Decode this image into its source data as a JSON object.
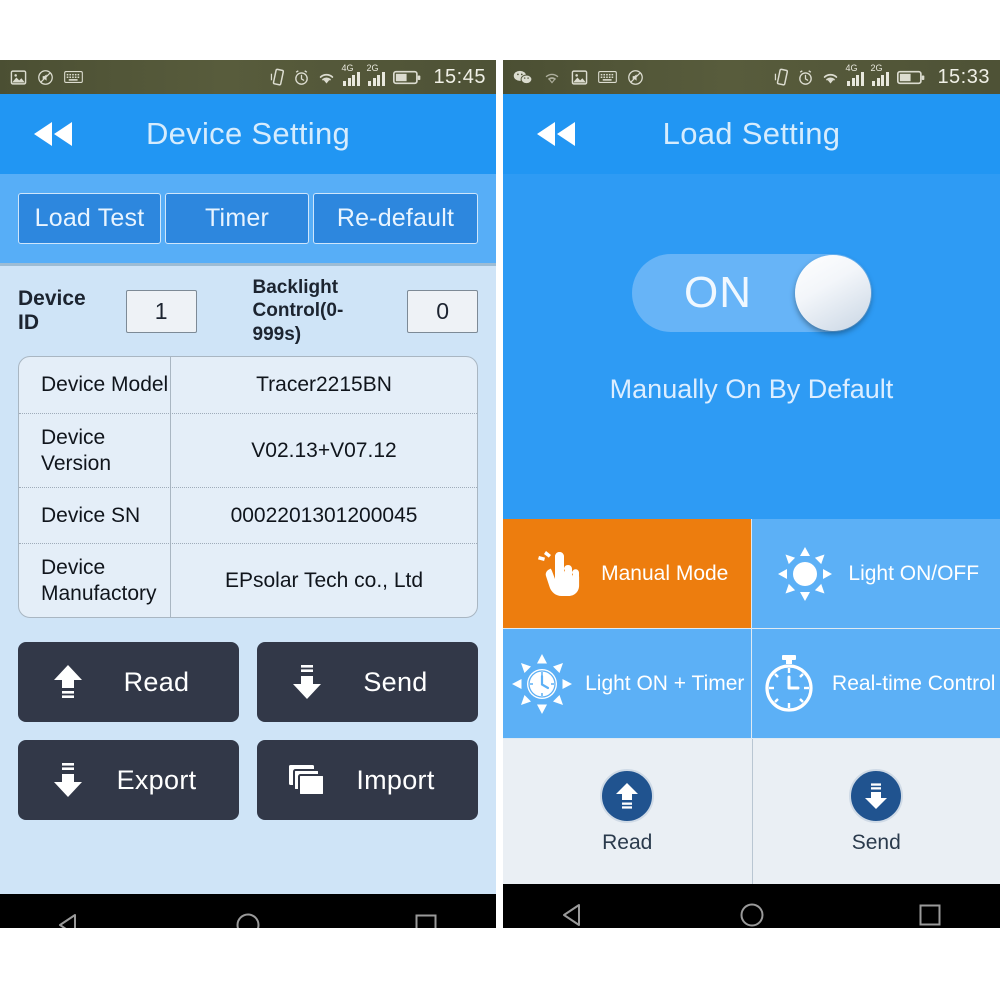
{
  "left": {
    "statusbar": {
      "time": "15:45",
      "left_icons": [
        "image-icon",
        "no-sound-icon",
        "keyboard-icon"
      ],
      "right_icons": [
        "vibrate-icon",
        "alarm-icon",
        "wifi-icon",
        "signal-4g-icon",
        "signal-2g-icon",
        "battery-icon"
      ],
      "net_4g_label": "4G",
      "net_2g_label": "2G"
    },
    "appbar": {
      "title": "Device Setting",
      "back_label": "back"
    },
    "tabs": [
      {
        "label": "Load Test",
        "name": "tab-load-test"
      },
      {
        "label": "Timer",
        "name": "tab-timer"
      },
      {
        "label": "Re-default",
        "name": "tab-re-default"
      }
    ],
    "fields": {
      "device_id_label": "Device ID",
      "device_id_value": "1",
      "backlight_label": "Backlight\nControl(0-999s)",
      "backlight_label_line1": "Backlight",
      "backlight_label_line2": "Control(0-999s)",
      "backlight_value": "0"
    },
    "table": [
      {
        "key": "Device Model",
        "value": "Tracer2215BN"
      },
      {
        "key": "Device Version",
        "value": "V02.13+V07.12"
      },
      {
        "key": "Device SN",
        "value": "0002201301200045"
      },
      {
        "key": "Device Manufactory",
        "value": "EPsolar Tech co., Ltd"
      }
    ],
    "buttons": [
      {
        "label": "Read",
        "icon": "arrow-up-icon"
      },
      {
        "label": "Send",
        "icon": "arrow-down-icon"
      },
      {
        "label": "Export",
        "icon": "arrow-down-icon"
      },
      {
        "label": "Import",
        "icon": "copy-stack-icon"
      }
    ]
  },
  "right": {
    "statusbar": {
      "time": "15:33",
      "left_icons": [
        "wechat-icon",
        "wifi-off-icon",
        "image-icon",
        "keyboard-icon",
        "no-sound-icon"
      ],
      "right_icons": [
        "vibrate-icon",
        "alarm-icon",
        "wifi-icon",
        "signal-4g-icon",
        "signal-2g-icon",
        "battery-icon"
      ],
      "net_4g_label": "4G",
      "net_2g_label": "2G"
    },
    "appbar": {
      "title": "Load Setting",
      "back_label": "back"
    },
    "toggle": {
      "state_label": "ON",
      "caption": "Manually On By Default"
    },
    "modes": [
      {
        "label": "Manual Mode",
        "icon": "hand-tap-icon",
        "active": true
      },
      {
        "label": "Light ON/OFF",
        "icon": "sun-icon",
        "active": false
      },
      {
        "label": "Light ON + Timer",
        "icon": "sun-clock-icon",
        "active": false
      },
      {
        "label": "Real-time Control",
        "icon": "stopwatch-icon",
        "active": false
      }
    ],
    "actions": [
      {
        "label": "Read",
        "icon": "arrow-up-circle-icon"
      },
      {
        "label": "Send",
        "icon": "arrow-down-circle-icon"
      }
    ]
  },
  "navbar": {
    "items": [
      {
        "name": "nav-back-icon",
        "glyph": "triangle-left"
      },
      {
        "name": "nav-home-icon",
        "glyph": "circle"
      },
      {
        "name": "nav-recents-icon",
        "glyph": "square"
      }
    ]
  },
  "colors": {
    "appbar_blue": "#2196f3",
    "tabstrip_blue": "#57aef7",
    "tab_fill": "#2d87de",
    "body_blue": "#cfe4f7",
    "dark_button": "#323848",
    "mode_blue": "#5cb0f6",
    "mode_active_orange": "#ed7d0e",
    "action_bg": "#eaeff4",
    "circle_blue": "#20538f",
    "statusbar": "#4e5236"
  }
}
